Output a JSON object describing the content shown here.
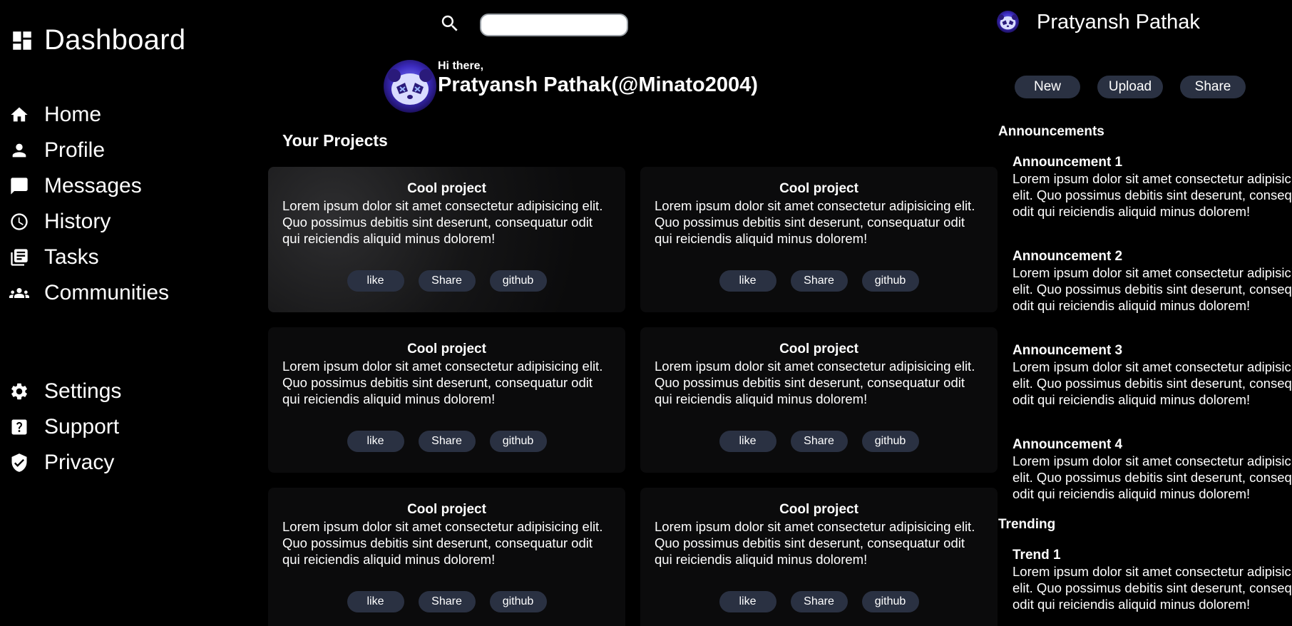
{
  "sidebar": {
    "brand_title": "Dashboard",
    "brand_icon": "dashboard-icon",
    "nav_main": [
      {
        "label": "Home",
        "icon": "home-icon"
      },
      {
        "label": "Profile",
        "icon": "person-icon"
      },
      {
        "label": "Messages",
        "icon": "chat-icon"
      },
      {
        "label": "History",
        "icon": "clock-icon"
      },
      {
        "label": "Tasks",
        "icon": "tasks-icon"
      },
      {
        "label": "Communities",
        "icon": "group-icon"
      }
    ],
    "nav_bottom": [
      {
        "label": "Settings",
        "icon": "gear-icon"
      },
      {
        "label": "Support",
        "icon": "help-icon"
      },
      {
        "label": "Privacy",
        "icon": "shield-icon"
      }
    ]
  },
  "search": {
    "placeholder": "",
    "value": ""
  },
  "greeting": {
    "hi": "Hi there,",
    "name": "Pratyansh Pathak(@Minato2004)"
  },
  "user": {
    "name": "Pratyansh Pathak"
  },
  "actions": {
    "new": "New",
    "upload": "Upload",
    "share": "Share"
  },
  "projects": {
    "title": "Your Projects",
    "cards": [
      {
        "title": "Cool project",
        "body": "Lorem ipsum dolor sit amet consectetur adipisicing elit. Quo possimus debitis sint deserunt, consequatur odit qui reiciendis aliquid minus dolorem!",
        "like": "like",
        "share": "Share",
        "github": "github"
      },
      {
        "title": "Cool project",
        "body": "Lorem ipsum dolor sit amet consectetur adipisicing elit. Quo possimus debitis sint deserunt, consequatur odit qui reiciendis aliquid minus dolorem!",
        "like": "like",
        "share": "Share",
        "github": "github"
      },
      {
        "title": "Cool project",
        "body": "Lorem ipsum dolor sit amet consectetur adipisicing elit. Quo possimus debitis sint deserunt, consequatur odit qui reiciendis aliquid minus dolorem!",
        "like": "like",
        "share": "Share",
        "github": "github"
      },
      {
        "title": "Cool project",
        "body": "Lorem ipsum dolor sit amet consectetur adipisicing elit. Quo possimus debitis sint deserunt, consequatur odit qui reiciendis aliquid minus dolorem!",
        "like": "like",
        "share": "Share",
        "github": "github"
      },
      {
        "title": "Cool project",
        "body": "Lorem ipsum dolor sit amet consectetur adipisicing elit. Quo possimus debitis sint deserunt, consequatur odit qui reiciendis aliquid minus dolorem!",
        "like": "like",
        "share": "Share",
        "github": "github"
      },
      {
        "title": "Cool project",
        "body": "Lorem ipsum dolor sit amet consectetur adipisicing elit. Quo possimus debitis sint deserunt, consequatur odit qui reiciendis aliquid minus dolorem!",
        "like": "like",
        "share": "Share",
        "github": "github"
      }
    ]
  },
  "announcements": {
    "title": "Announcements",
    "items": [
      {
        "title": "Announcement 1",
        "lines": [
          "Lorem ipsum dolor sit amet consectetur adipisicing",
          "elit. Quo possimus debitis sint deserunt, consequatur",
          "odit qui reiciendis aliquid minus dolorem!"
        ]
      },
      {
        "title": "Announcement 2",
        "lines": [
          "Lorem ipsum dolor sit amet consectetur adipisicing",
          "elit. Quo possimus debitis sint deserunt, consequatur",
          "odit qui reiciendis aliquid minus dolorem!"
        ]
      },
      {
        "title": "Announcement 3",
        "lines": [
          "Lorem ipsum dolor sit amet consectetur adipisicing",
          "elit. Quo possimus debitis sint deserunt, consequatur",
          "odit qui reiciendis aliquid minus dolorem!"
        ]
      },
      {
        "title": "Announcement 4",
        "lines": [
          "Lorem ipsum dolor sit amet consectetur adipisicing",
          "elit. Quo possimus debitis sint deserunt, consequatur",
          "odit qui reiciendis aliquid minus dolorem!"
        ]
      }
    ]
  },
  "trending": {
    "title": "Trending",
    "items": [
      {
        "title": "Trend 1",
        "lines": [
          "Lorem ipsum dolor sit amet consectetur adipisicing",
          "elit. Quo possimus debitis sint deserunt, consequatur",
          "odit qui reiciendis aliquid minus dolorem!"
        ]
      }
    ]
  },
  "colors": {
    "background": "#000000",
    "card": "#0b0b0c",
    "pill": "#2a3142",
    "text": "#ffffff"
  }
}
